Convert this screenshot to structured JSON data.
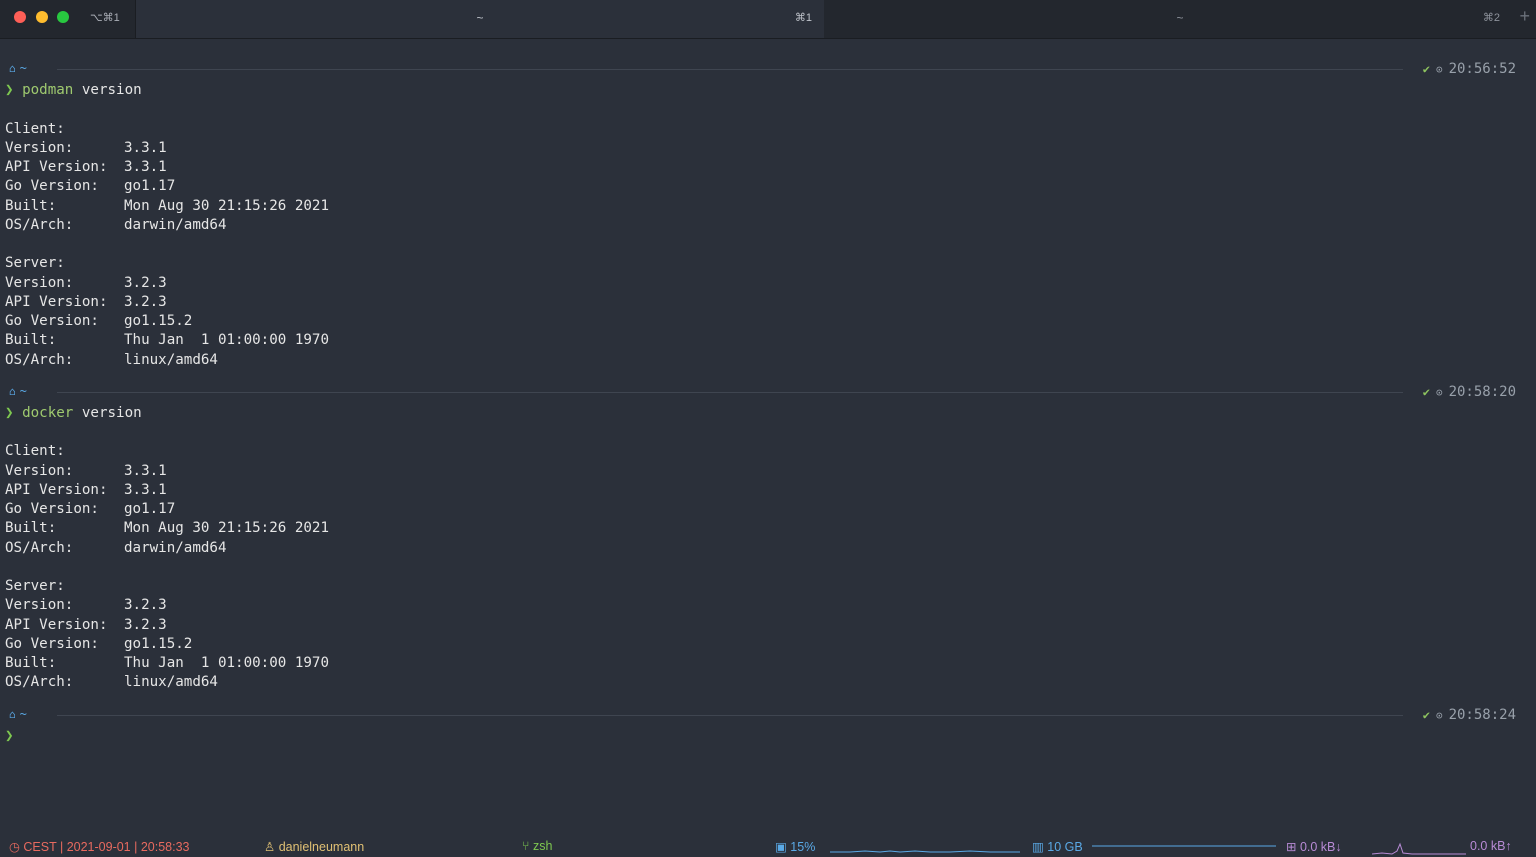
{
  "window": {
    "shortcut": "⌥⌘1",
    "tabs": [
      {
        "title": "~",
        "key": "⌘1",
        "active": true
      },
      {
        "title": "~",
        "key": "⌘2",
        "active": false
      }
    ],
    "new_tab_label": "+"
  },
  "blocks": [
    {
      "prompt": {
        "path": "~",
        "status": "✔",
        "time": "20:56:52"
      },
      "command": {
        "caret": "❯",
        "program": "podman",
        "args": "version"
      },
      "sections": [
        {
          "header": "Client:",
          "rows": [
            {
              "k": "Version:",
              "v": "3.3.1"
            },
            {
              "k": "API Version:",
              "v": "3.3.1"
            },
            {
              "k": "Go Version:",
              "v": "go1.17"
            },
            {
              "k": "Built:",
              "v": "Mon Aug 30 21:15:26 2021"
            },
            {
              "k": "OS/Arch:",
              "v": "darwin/amd64"
            }
          ]
        },
        {
          "header": "Server:",
          "rows": [
            {
              "k": "Version:",
              "v": "3.2.3"
            },
            {
              "k": "API Version:",
              "v": "3.2.3"
            },
            {
              "k": "Go Version:",
              "v": "go1.15.2"
            },
            {
              "k": "Built:",
              "v": "Thu Jan  1 01:00:00 1970"
            },
            {
              "k": "OS/Arch:",
              "v": "linux/amd64"
            }
          ]
        }
      ]
    },
    {
      "prompt": {
        "path": "~",
        "status": "✔",
        "time": "20:58:20"
      },
      "command": {
        "caret": "❯",
        "program": "docker",
        "args": "version"
      },
      "sections": [
        {
          "header": "Client:",
          "rows": [
            {
              "k": "Version:",
              "v": "3.3.1"
            },
            {
              "k": "API Version:",
              "v": "3.3.1"
            },
            {
              "k": "Go Version:",
              "v": "go1.17"
            },
            {
              "k": "Built:",
              "v": "Mon Aug 30 21:15:26 2021"
            },
            {
              "k": "OS/Arch:",
              "v": "darwin/amd64"
            }
          ]
        },
        {
          "header": "Server:",
          "rows": [
            {
              "k": "Version:",
              "v": "3.2.3"
            },
            {
              "k": "API Version:",
              "v": "3.2.3"
            },
            {
              "k": "Go Version:",
              "v": "go1.15.2"
            },
            {
              "k": "Built:",
              "v": "Thu Jan  1 01:00:00 1970"
            },
            {
              "k": "OS/Arch:",
              "v": "linux/amd64"
            }
          ]
        }
      ]
    }
  ],
  "final_prompt": {
    "path": "~",
    "status": "✔",
    "time": "20:58:24",
    "caret": "❯"
  },
  "statusbar": {
    "time": "CEST | 2021-09-01 | 20:58:33",
    "user": "danielneumann",
    "shell": "zsh",
    "cpu": "15%",
    "memory": "10 GB",
    "net_down": "0.0 kB↓",
    "net_up": "0.0 kB↑"
  },
  "colors": {
    "background": "#2b303a",
    "command": "#9fca6f",
    "caret": "#7ec850",
    "path": "#5aa9e6",
    "time_status": "#e86a5f",
    "user": "#e0c074",
    "cpu_mem": "#5aa9e6",
    "network": "#b88bd6"
  },
  "icons": {
    "os": "apple-icon",
    "home": "home-icon",
    "status_ok": "check-icon",
    "clock": "clock-icon",
    "user": "user-icon",
    "branch": "branch-icon",
    "cpu": "cpu-icon",
    "memory": "memory-icon",
    "network": "network-icon"
  }
}
